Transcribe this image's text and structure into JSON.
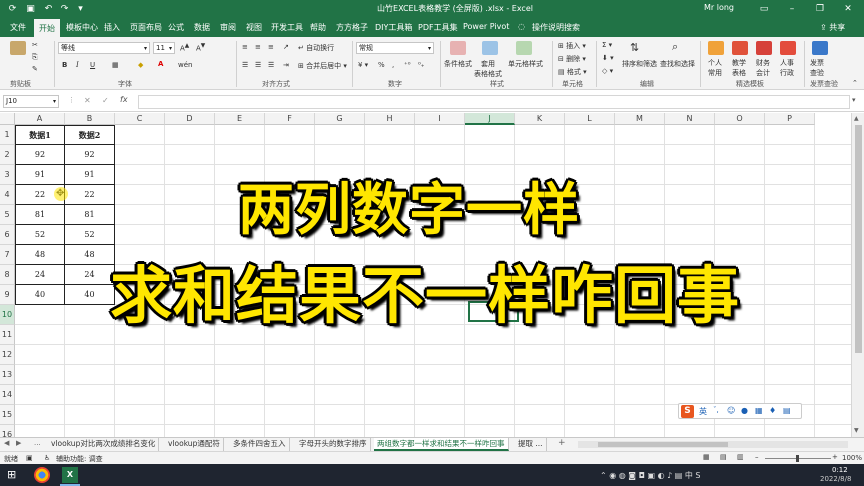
{
  "app": {
    "window_title": "山竹EXCEL表格教学 (全屏版) .xlsx  -  Excel",
    "user": "Mr long",
    "ribbon_display_icon": "ribbon-display-icon",
    "accent": "#217346"
  },
  "tabs": [
    "文件",
    "开始",
    "模板中心",
    "插入",
    "页面布局",
    "公式",
    "数据",
    "审阅",
    "视图",
    "开发工具",
    "帮助",
    "方方格子",
    "DIY工具箱",
    "PDF工具集",
    "Power Pivot",
    "操作说明搜索"
  ],
  "active_tab": "开始",
  "share_label": "共享",
  "ribbon": {
    "font_name": "等线",
    "font_size": "11",
    "number_format": "常规",
    "wrap_text": "自动换行",
    "merge_center": "合并后居中",
    "bold": "B",
    "italic": "I",
    "underline": "U",
    "conditional_format": "条件格式",
    "table_format": "套用\n表格格式",
    "cell_style": "单元格样式",
    "insert": "插入",
    "delete": "删除",
    "format": "格式",
    "sort_filter": "排序和筛选",
    "find_select": "查找和选择",
    "personal": "个人\n常用",
    "teach": "教学\n表格",
    "finance": "财务\n会计",
    "hr": "人事\n行政",
    "dupcheck": "发票\n查验",
    "groups": {
      "clipboard": "剪贴板",
      "font": "字体",
      "alignment": "对齐方式",
      "number": "数字",
      "styles": "样式",
      "cells": "单元格",
      "editing": "编辑",
      "templates": "精选模板",
      "invoice": "发票查验"
    }
  },
  "formula_bar": {
    "name_box": "J10",
    "fx": "fx",
    "formula": ""
  },
  "grid": {
    "columns": [
      "A",
      "B",
      "C",
      "D",
      "E",
      "F",
      "G",
      "H",
      "I",
      "J",
      "K",
      "L",
      "M",
      "N",
      "O",
      "P"
    ],
    "rows": [
      "1",
      "2",
      "3",
      "4",
      "5",
      "6",
      "7",
      "8",
      "9",
      "10",
      "11",
      "12",
      "13",
      "14",
      "15",
      "16"
    ],
    "selected_cell": "J10",
    "headers": [
      "数据1",
      "数据2"
    ],
    "data": [
      [
        "92",
        "92"
      ],
      [
        "91",
        "91"
      ],
      [
        "22",
        "22"
      ],
      [
        "81",
        "81"
      ],
      [
        "52",
        "52"
      ],
      [
        "48",
        "48"
      ],
      [
        "24",
        "24"
      ],
      [
        "40",
        "40"
      ]
    ]
  },
  "overlay": {
    "line1": "两列数字一样",
    "line2": "求和结果不一样咋回事",
    "color": "#ffe600"
  },
  "sheet_tabs": {
    "nav": [
      "◀",
      "▶",
      "..."
    ],
    "tabs": [
      "vlookup对比两次成绩排名变化",
      "vlookup通配符",
      "多条件四舍五入",
      "字母开头的数字排序",
      "两组数字都一样求和结果不一样咋回事",
      "提取 ..."
    ],
    "active": "两组数字都一样求和结果不一样咋回事",
    "add": "+"
  },
  "status": {
    "ready": "就绪",
    "accessibility": "辅助功能: 调查",
    "zoom": "100%"
  },
  "ime": {
    "logo": "S",
    "lang": "英"
  },
  "taskbar": {
    "time": "0:12",
    "date": "2022/8/8"
  }
}
